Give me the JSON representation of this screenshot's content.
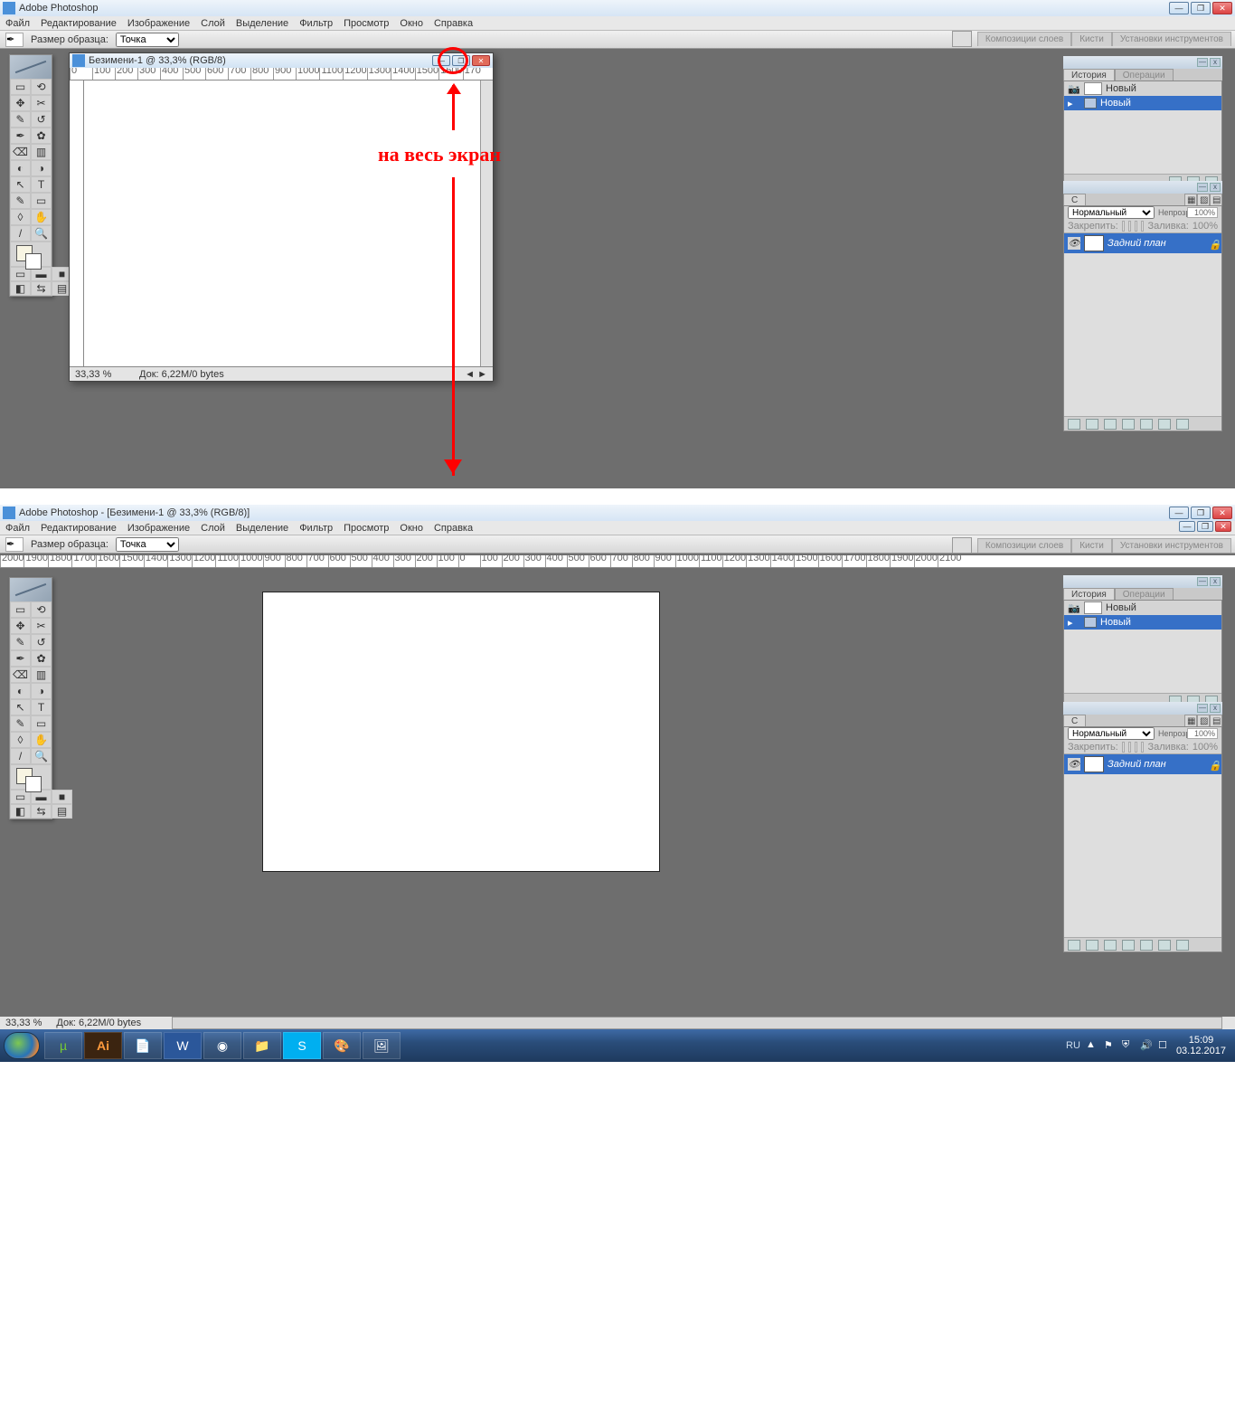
{
  "app": {
    "title_top": "Adobe Photoshop",
    "title_bottom": "Adobe Photoshop - [Безимени-1 @ 33,3% (RGB/8)]"
  },
  "menu": [
    "Файл",
    "Редактирование",
    "Изображение",
    "Слой",
    "Выделение",
    "Фильтр",
    "Просмотр",
    "Окно",
    "Справка"
  ],
  "options": {
    "sample_label": "Размер образца:",
    "sample_value": "Точка"
  },
  "panel_tabs": [
    "Композиции слоев",
    "Кисти",
    "Установки инструментов"
  ],
  "doc": {
    "title": "Безимени-1 @ 33,3% (RGB/8)",
    "zoom": "33,33 %",
    "dock": "Док: 6,22M/0 bytes"
  },
  "history": {
    "tab_a": "История",
    "tab_b": "Операции",
    "root": "Новый",
    "step": "Новый"
  },
  "layers": {
    "tab": "С",
    "mode": "Нормальный",
    "opacity_lbl": "Непрозр.:",
    "opacity_val": "100%",
    "lock_lbl": "Закрепить:",
    "fill_lbl": "Заливка:",
    "fill_val": "100%",
    "bg": "Задний план"
  },
  "ruler_marks": [
    "0",
    "100",
    "200",
    "300",
    "400",
    "500",
    "600",
    "700",
    "800",
    "900",
    "1000",
    "1100",
    "1200",
    "1300",
    "1400",
    "1500",
    "1600",
    "170"
  ],
  "ruler_full": [
    "2000",
    "1900",
    "1800",
    "1700",
    "1600",
    "1500",
    "1400",
    "1300",
    "1200",
    "1100",
    "1000",
    "900",
    "800",
    "700",
    "600",
    "500",
    "400",
    "300",
    "200",
    "100",
    "0",
    "100",
    "200",
    "300",
    "400",
    "500",
    "600",
    "700",
    "800",
    "900",
    "1000",
    "1100",
    "1200",
    "1300",
    "1400",
    "1500",
    "1600",
    "1700",
    "1800",
    "1900",
    "2000",
    "2100"
  ],
  "annotation": "на весь экран",
  "taskbar": {
    "lang": "RU",
    "time": "15:09",
    "date": "03.12.2017"
  }
}
